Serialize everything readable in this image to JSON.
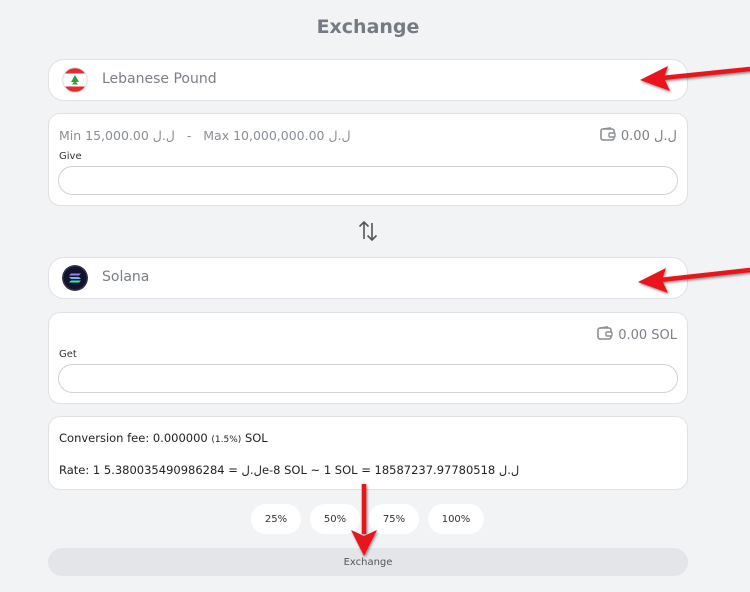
{
  "header": {
    "title": "Exchange"
  },
  "give": {
    "currency_name": "Lebanese Pound",
    "min_label": "Min 15,000.00 ل.ل",
    "separator": "-",
    "max_label": "Max 10,000,000.00 ل.ل",
    "balance": "0.00 ل.ل",
    "field_label": "Give",
    "value": ""
  },
  "get": {
    "currency_name": "Solana",
    "balance": "0.00 SOL",
    "field_label": "Get",
    "value": ""
  },
  "info": {
    "fee_prefix": "Conversion fee: 0.000000",
    "fee_pct": "(1.5%)",
    "fee_suffix": "SOL",
    "rate": "Rate: 1 ل.ل = 5.380035490986284e-8 SOL ~ 1 SOL = 18587237.97780518 ل.ل"
  },
  "percent_buttons": [
    "25%",
    "50%",
    "75%",
    "100%"
  ],
  "exchange_button": "Exchange",
  "icons": {
    "give_currency": "lebanon-flag-icon",
    "get_currency": "solana-logo-icon",
    "balance": "wallet-icon",
    "swap": "swap-arrows-icon"
  },
  "colors": {
    "annotation_arrow": "#e8141c",
    "solana_badge": "#13132b"
  }
}
